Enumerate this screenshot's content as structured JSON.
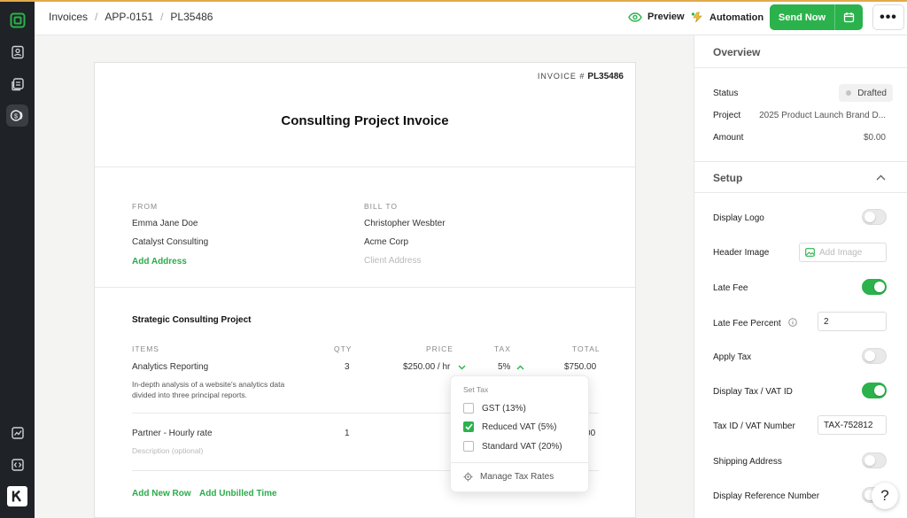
{
  "breadcrumbs": [
    "Invoices",
    "APP-0151",
    "PL35486"
  ],
  "header": {
    "preview_label": "Preview",
    "automation_label": "Automation",
    "send_label": "Send Now",
    "more_label": "•••"
  },
  "invoice": {
    "number_label": "INVOICE #",
    "number": "PL35486",
    "title": "Consulting Project Invoice",
    "from": {
      "label": "FROM",
      "name": "Emma Jane Doe",
      "company": "Catalyst Consulting",
      "add_address": "Add Address"
    },
    "bill_to": {
      "label": "BILL TO",
      "name": "Christopher Wesbter",
      "company": "Acme Corp",
      "address_placeholder": "Client Address"
    },
    "project_title": "Strategic Consulting Project",
    "columns": {
      "items": "ITEMS",
      "qty": "QTY",
      "price": "PRICE",
      "tax": "TAX",
      "total": "TOTAL"
    },
    "rows": [
      {
        "name": "Analytics Reporting",
        "qty": "3",
        "price": "$250.00 / hr",
        "tax": "5%",
        "total": "$750.00",
        "desc1": "In-depth analysis of a website's analytics data",
        "desc2": "divided into three principal reports."
      },
      {
        "name": "Partner - Hourly rate",
        "qty": "1",
        "total": "$300.00",
        "desc_placeholder": "Description (optional)"
      }
    ],
    "add_row": "Add New Row",
    "add_unbilled": "Add Unbilled Time"
  },
  "tax_popup": {
    "title": "Set Tax",
    "options": [
      {
        "label": "GST (13%)",
        "checked": false
      },
      {
        "label": "Reduced VAT (5%)",
        "checked": true
      },
      {
        "label": "Standard VAT (20%)",
        "checked": false
      }
    ],
    "manage": "Manage Tax Rates"
  },
  "sidebar": {
    "overview_title": "Overview",
    "status_label": "Status",
    "status_value": "Drafted",
    "project_label": "Project",
    "project_value": "2025 Product Launch Brand D...",
    "amount_label": "Amount",
    "amount_value": "$0.00",
    "setup_title": "Setup",
    "display_logo": "Display Logo",
    "header_image": "Header Image",
    "add_image_placeholder": "Add Image",
    "late_fee": "Late Fee",
    "late_fee_percent": "Late Fee Percent",
    "late_fee_percent_value": "2",
    "apply_tax": "Apply Tax",
    "display_tax_id": "Display Tax / VAT ID",
    "tax_id_label": "Tax ID / VAT Number",
    "tax_id_value": "TAX-752812",
    "shipping_address": "Shipping Address",
    "display_reference": "Display Reference Number"
  },
  "help_label": "?",
  "colors": {
    "accent": "#2bb24c",
    "rail": "#1f2226"
  }
}
